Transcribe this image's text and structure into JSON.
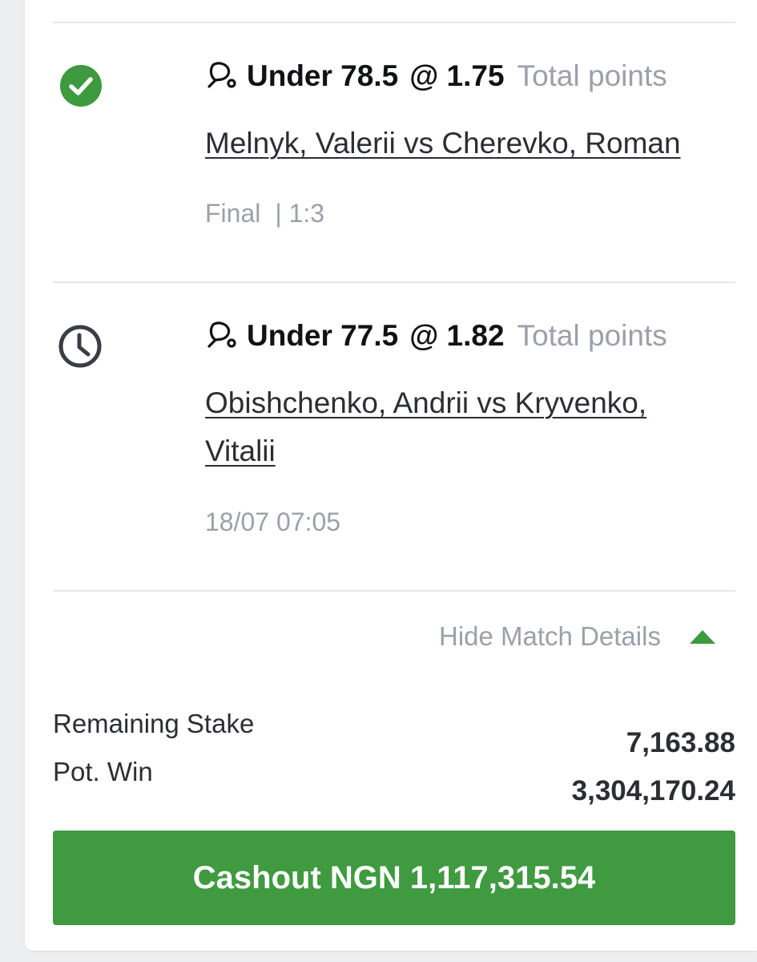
{
  "bets": [
    {
      "status": "won",
      "status_icon": "check-circle-icon",
      "sport_icon": "table-tennis-icon",
      "pick": "Under 78.5",
      "odds": "@ 1.75",
      "market": "Total points",
      "event": "Melnyk, Valerii vs Cherevko, Roman",
      "state": "Final",
      "score": "| 1:3"
    },
    {
      "status": "pending",
      "status_icon": "clock-icon",
      "sport_icon": "table-tennis-icon",
      "pick": "Under 77.5",
      "odds": "@ 1.82",
      "market": "Total points",
      "event_line1": "Obishchenko, Andrii vs Kryvenko,",
      "event_line2": "Vitalii",
      "datetime": "18/07 07:05"
    }
  ],
  "details_toggle": {
    "label": "Hide Match Details",
    "icon": "caret-up-icon"
  },
  "summary": {
    "remaining_stake_label": "Remaining Stake",
    "remaining_stake_value": "7,163.88",
    "pot_win_label": "Pot. Win",
    "pot_win_value": "3,304,170.24"
  },
  "cashout": {
    "label": "Cashout NGN 1,117,315.54"
  },
  "colors": {
    "accent_green": "#3f9a40",
    "muted_text": "#9ca0a8",
    "primary_text": "#111214"
  }
}
